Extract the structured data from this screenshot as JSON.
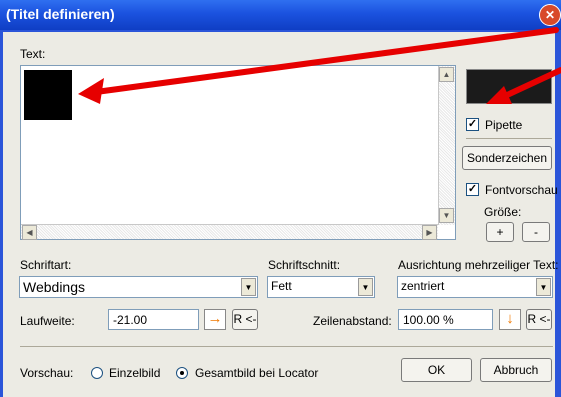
{
  "window": {
    "title": "(Titel definieren)",
    "close_glyph": "✕"
  },
  "text_section": {
    "label": "Text:"
  },
  "preview_color": {
    "color": "#1b1b1b"
  },
  "pipette": {
    "label": "Pipette",
    "checked": true,
    "mark": "✓"
  },
  "sonderzeichen": {
    "label": "Sonderzeichen"
  },
  "fontvorschau": {
    "label": "Fontvorschau",
    "checked": true,
    "mark": "✓",
    "size_label": "Größe:",
    "plus": "+",
    "minus": "-"
  },
  "schriftart": {
    "label": "Schriftart:",
    "value": "Webdings"
  },
  "schriftschnitt": {
    "label": "Schriftschnitt:",
    "value": "Fett"
  },
  "ausrichtung": {
    "label": "Ausrichtung mehrzeiliger Text:",
    "value": "zentriert"
  },
  "laufweite": {
    "label": "Laufweite:",
    "value": "-21.00",
    "reset": "R <-"
  },
  "zeilenabstand": {
    "label": "Zeilenabstand:",
    "value": "100.00 %",
    "reset": "R <-"
  },
  "vorschau": {
    "label": "Vorschau:",
    "option1": "Einzelbild",
    "option2": "Gesamtbild bei Locator",
    "selected": "Gesamtbild bei Locator"
  },
  "buttons": {
    "ok": "OK",
    "cancel": "Abbruch"
  },
  "annotation": {
    "arrow_color": "#e60000"
  }
}
